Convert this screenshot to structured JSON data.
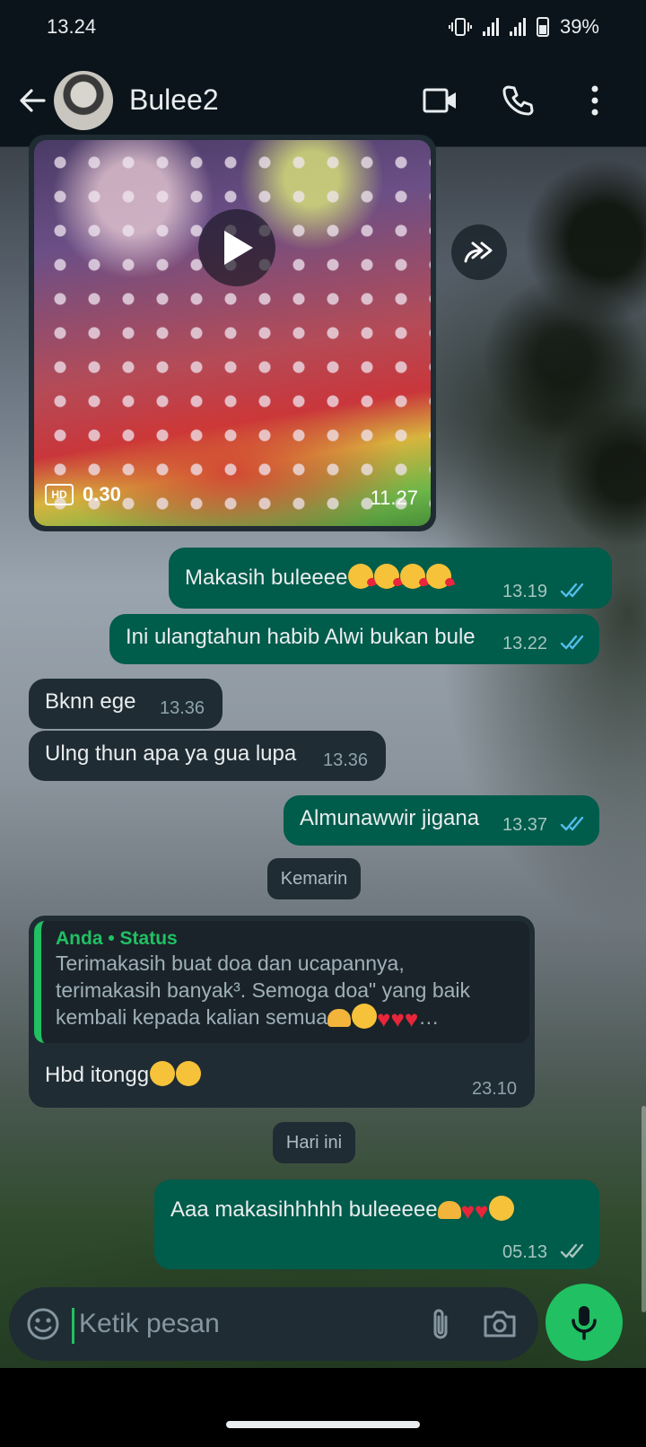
{
  "status_bar": {
    "time": "13.24",
    "battery": "39%"
  },
  "header": {
    "contact_name": "Bulee2"
  },
  "video_message": {
    "hd_label": "HD",
    "duration": "0.30",
    "time": "11.27"
  },
  "messages": [
    {
      "direction": "out",
      "text": "Makasih buleeee",
      "emoji": [
        "kissing-heart-face",
        "kissing-heart-face",
        "kissing-heart-face",
        "kissing-heart-face"
      ],
      "time": "13.19",
      "status": "read"
    },
    {
      "direction": "out",
      "text": "Ini ulangtahun habib Alwi bukan bule",
      "time": "13.22",
      "status": "read"
    },
    {
      "direction": "in",
      "text": "Bknn ege",
      "time": "13.36"
    },
    {
      "direction": "in",
      "text": "Ulng thun apa ya gua lupa",
      "time": "13.36"
    },
    {
      "direction": "out",
      "text": "Almunawwir jigana",
      "time": "13.37",
      "status": "read"
    }
  ],
  "date_separators": [
    "Kemarin",
    "Hari ini"
  ],
  "reply_message": {
    "quote_author": "Anda",
    "quote_separator": "•",
    "quote_source": "Status",
    "quote_lines": [
      "Terimakasih buat doa dan ucapannya,",
      "terimakasih banyak³. Semoga doa\" yang baik",
      "kembali kepada kalian semua"
    ],
    "quote_ellipsis": "…",
    "text": "Hbd itongg",
    "emoji": [
      "partying-face",
      "star-struck-face"
    ],
    "time": "23.10"
  },
  "last_message": {
    "direction": "out",
    "text": "Aaa makasihhhhh buleeeee",
    "emoji": [
      "heart-hands",
      "red-heart",
      "red-heart",
      "pleading-face"
    ],
    "time": "05.13",
    "status": "delivered"
  },
  "composer": {
    "placeholder": "Ketik pesan"
  },
  "colors": {
    "incoming_bubble": "#1f2c34",
    "outgoing_bubble": "#005c4b",
    "accent": "#21c063",
    "read_tick": "#53bdeb"
  }
}
